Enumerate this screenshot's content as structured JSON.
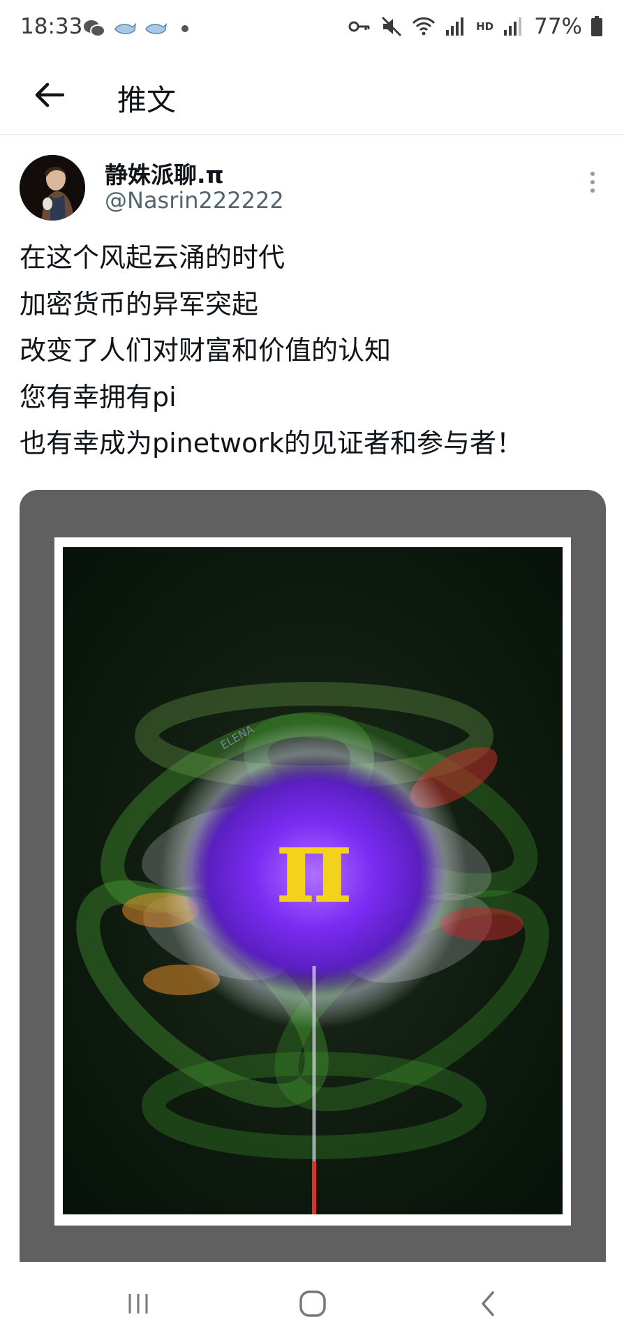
{
  "status_bar": {
    "time": "18:33",
    "battery_percent": "77%",
    "network_label": "HD",
    "left_icons": [
      "wechat-icon",
      "whale-icon",
      "whale-icon",
      "dot-icon"
    ],
    "right_icons": [
      "key-icon",
      "mute-icon",
      "wifi-icon",
      "signal-icon",
      "signal-icon",
      "battery-icon"
    ]
  },
  "header": {
    "title": "推文"
  },
  "tweet": {
    "author_name": "静姝派聊.π",
    "author_handle": "@Nasrin222222",
    "lines": [
      "在这个风起云涌的时代",
      "加密货币的异军突起",
      "改变了人们对财富和价值的认知",
      "您有幸拥有pi",
      "也有幸成为pinetwork的见证者和参与者！"
    ],
    "image_symbol": "π",
    "image_watermark": "ELENA"
  },
  "colors": {
    "text_primary": "#0f1419",
    "text_secondary": "#536471",
    "media_bg": "#606060",
    "pi_yellow": "#f3d21c",
    "flower_purple": "#7a2cf2"
  }
}
